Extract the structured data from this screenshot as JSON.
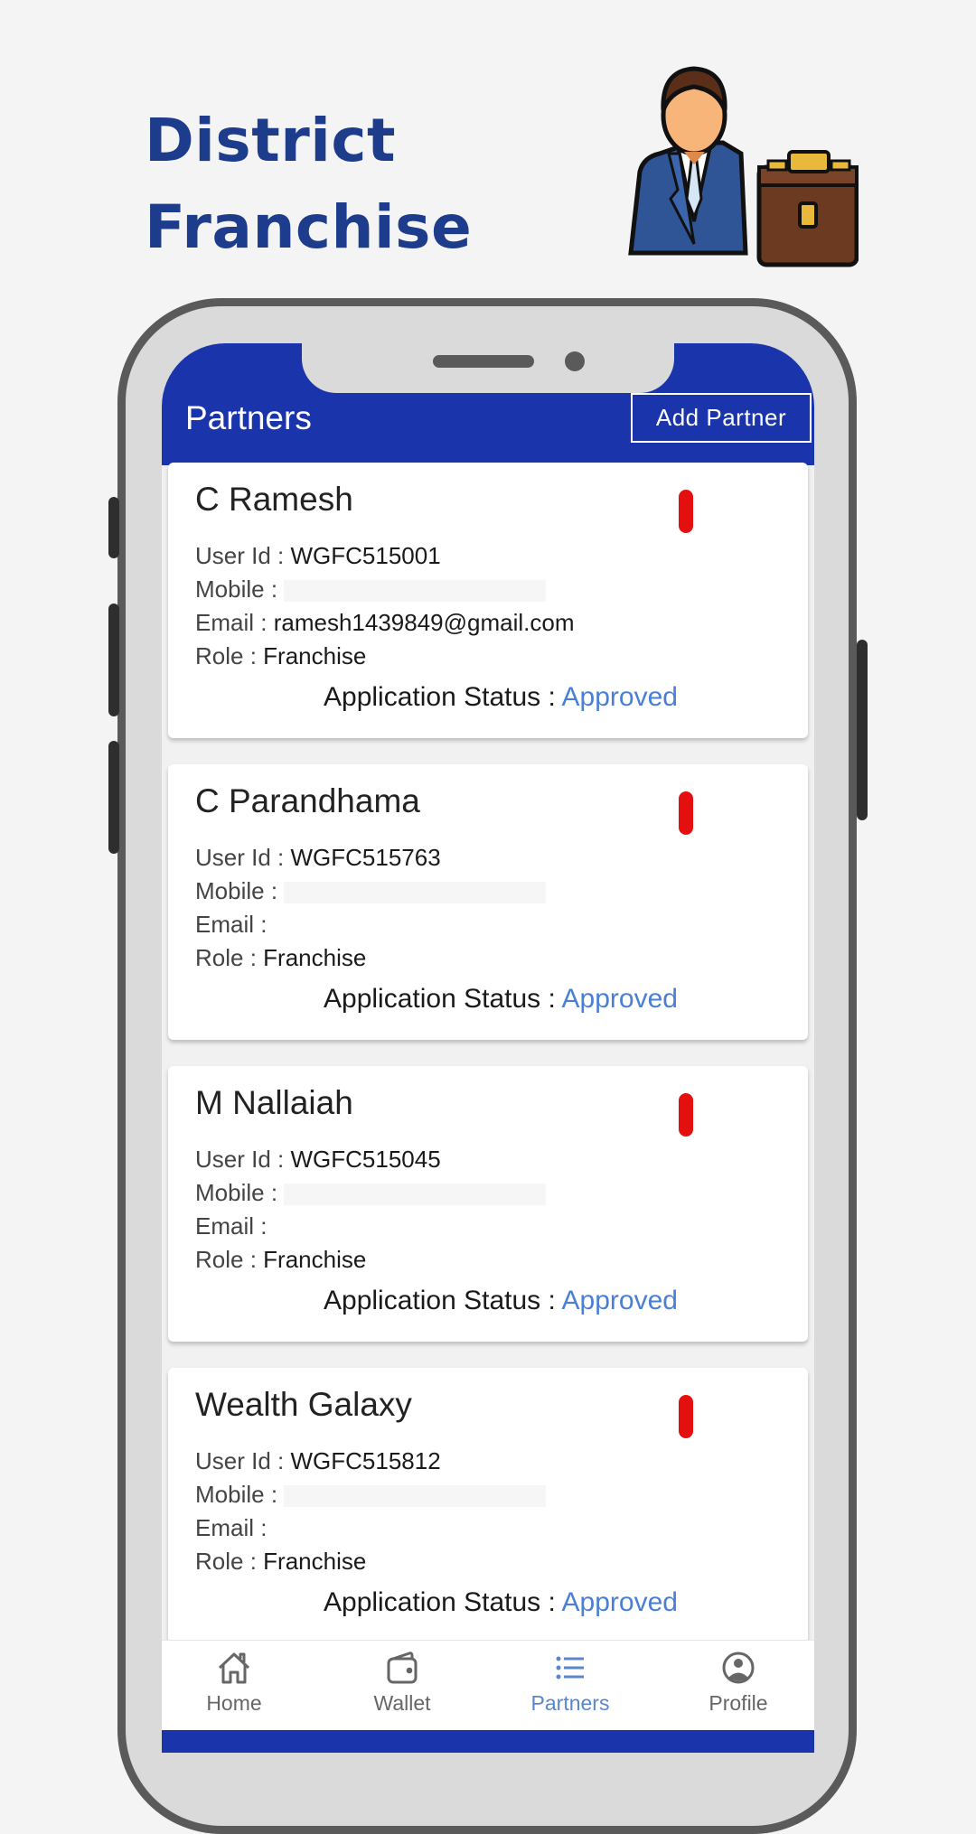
{
  "promo": {
    "title_line1": "District",
    "title_line2": "Franchise",
    "hero_icon": "businessman-with-briefcase-icon"
  },
  "colors": {
    "brand": "#1a34ac",
    "promo_title": "#1e3c8c",
    "status_approved": "#4a7fd6",
    "toggle": "#e41010",
    "nav_active": "#5a86cc"
  },
  "appbar": {
    "title": "Partners",
    "add_button": "Add Partner"
  },
  "labels": {
    "user_id": "User Id :",
    "mobile": "Mobile :",
    "email": "Email :",
    "role": "Role :",
    "status": "Application Status :"
  },
  "partners": [
    {
      "name": "C Ramesh",
      "user_id": "WGFC515001",
      "mobile": "",
      "email": "ramesh1439849@gmail.com",
      "role": "Franchise",
      "status": "Approved"
    },
    {
      "name": "C Parandhama",
      "user_id": "WGFC515763",
      "mobile": "",
      "email": "",
      "role": "Franchise",
      "status": "Approved"
    },
    {
      "name": "M Nallaiah",
      "user_id": "WGFC515045",
      "mobile": "",
      "email": "",
      "role": "Franchise",
      "status": "Approved"
    },
    {
      "name": "Wealth Galaxy",
      "user_id": "WGFC515812",
      "mobile": "",
      "email": "",
      "role": "Franchise",
      "status": "Approved"
    }
  ],
  "bottom_nav": [
    {
      "label": "Home",
      "icon": "home-icon",
      "active": false
    },
    {
      "label": "Wallet",
      "icon": "wallet-icon",
      "active": false
    },
    {
      "label": "Partners",
      "icon": "list-icon",
      "active": true
    },
    {
      "label": "Profile",
      "icon": "profile-icon",
      "active": false
    }
  ]
}
